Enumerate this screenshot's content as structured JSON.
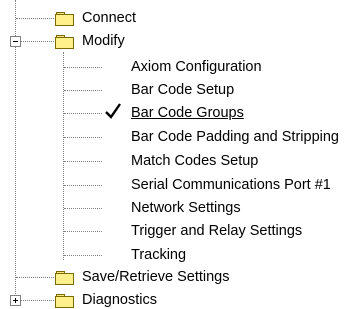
{
  "tree": {
    "nodes": [
      {
        "label": "Connect",
        "icon": "folder-icon"
      },
      {
        "label": "Modify",
        "icon": "folder-icon",
        "expander": "minus",
        "children": [
          {
            "label": "Axiom Configuration"
          },
          {
            "label": "Bar Code Setup"
          },
          {
            "label": "Bar Code Groups",
            "selected": true,
            "marker": "checkmark-icon"
          },
          {
            "label": "Bar Code Padding and Stripping"
          },
          {
            "label": "Match Codes Setup"
          },
          {
            "label": "Serial Communications Port #1"
          },
          {
            "label": "Network Settings"
          },
          {
            "label": "Trigger and Relay Settings"
          },
          {
            "label": "Tracking"
          }
        ]
      },
      {
        "label": "Save/Retrieve Settings",
        "icon": "folder-icon"
      },
      {
        "label": "Diagnostics",
        "icon": "folder-icon",
        "expander": "plus"
      }
    ]
  },
  "colors": {
    "folder_fill": "#fff08c",
    "folder_outline": "#7a6a00",
    "connector": "#808080"
  }
}
